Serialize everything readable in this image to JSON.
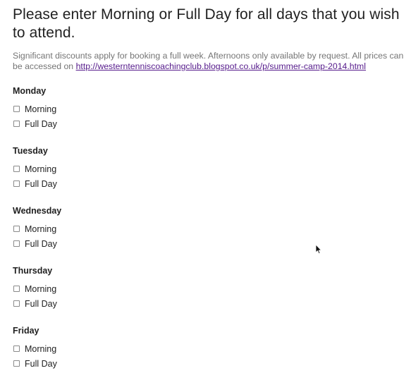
{
  "question": {
    "title": "Please enter Morning or Full Day for all days that you wish to attend.",
    "help_prefix": "Significant discounts apply for booking a full week. Afternoons only available by request. All prices can be accessed on ",
    "help_link": "http://westerntenniscoachingclub.blogspot.co.uk/p/summer-camp-2014.html"
  },
  "days": [
    {
      "label": "Monday",
      "options": [
        "Morning",
        "Full Day"
      ]
    },
    {
      "label": "Tuesday",
      "options": [
        "Morning",
        "Full Day"
      ]
    },
    {
      "label": "Wednesday",
      "options": [
        "Morning",
        "Full Day"
      ]
    },
    {
      "label": "Thursday",
      "options": [
        "Morning",
        "Full Day"
      ]
    },
    {
      "label": "Friday",
      "options": [
        "Morning",
        "Full Day"
      ]
    }
  ],
  "colors": {
    "text": "#212121",
    "help_text": "#757575",
    "link": "#551a8b",
    "checkbox_border": "#8a8a8a"
  }
}
